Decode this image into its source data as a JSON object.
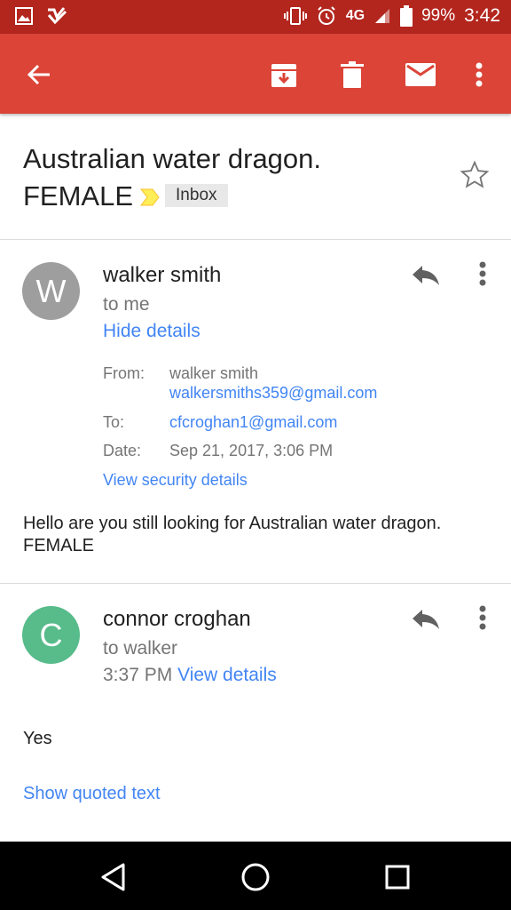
{
  "status_bar": {
    "network": "4G",
    "battery": "99%",
    "time": "3:42",
    "icons": [
      "image-icon",
      "notification-check-icon",
      "vibrate-icon",
      "alarm-icon",
      "signal-icon",
      "battery-icon"
    ]
  },
  "app_bar": {
    "color": "#db4437",
    "actions": [
      "back-arrow-icon",
      "archive-icon",
      "delete-icon",
      "mark-unread-icon",
      "more-vert-icon"
    ]
  },
  "thread": {
    "subject_line1": "Australian water dragon.",
    "subject_line2": "FEMALE",
    "label": "Inbox",
    "label_marker_color": "#ffee58"
  },
  "messages": [
    {
      "avatar_letter": "W",
      "avatar_color": "#9e9e9e",
      "sender": "walker smith",
      "recipient": "to me",
      "toggle_link": "Hide details",
      "details": {
        "from_label": "From:",
        "from_name": "walker smith",
        "from_email": "walkersmiths359@gmail.com",
        "to_label": "To:",
        "to_email": "cfcroghan1@gmail.com",
        "date_label": "Date:",
        "date_value": "Sep 21, 2017, 3:06 PM",
        "security_link": "View security details"
      },
      "body_line1": "Hello are you still looking for Australian water dragon.",
      "body_line2": "FEMALE"
    },
    {
      "avatar_letter": "C",
      "avatar_color": "#57bb8a",
      "sender": "connor croghan",
      "recipient": "to walker",
      "time": "3:37 PM",
      "details_link": "View details",
      "body": "Yes",
      "quoted_link": "Show quoted text"
    }
  ],
  "nav_bar": {
    "buttons": [
      "back-triangle-icon",
      "home-circle-icon",
      "recents-square-icon"
    ]
  }
}
